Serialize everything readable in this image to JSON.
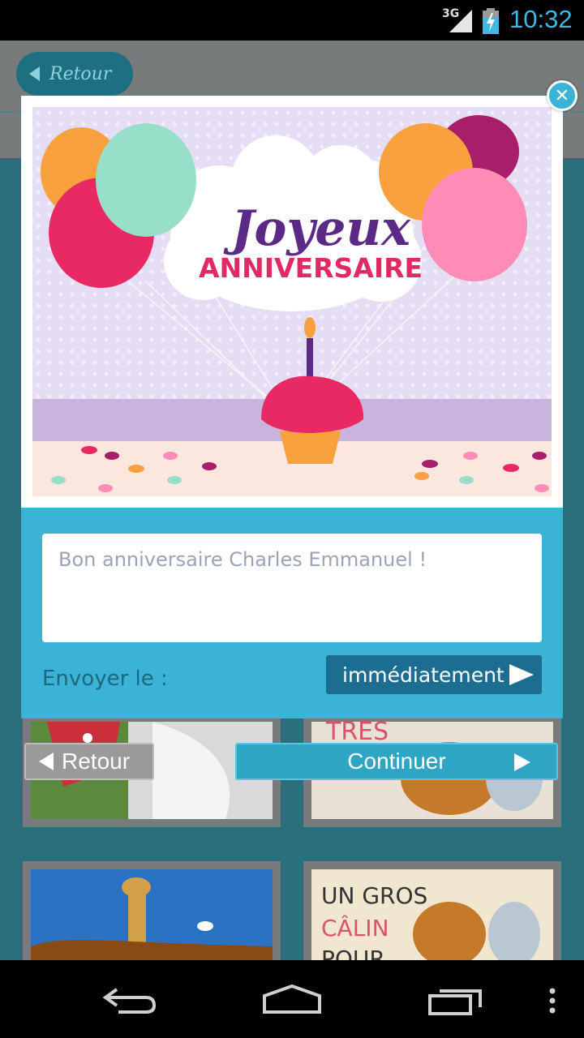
{
  "status_bar": {
    "network": "3G",
    "time": "10:32"
  },
  "header": {
    "back_label": "Retour"
  },
  "grid": {
    "cards": [
      {
        "text": ""
      },
      {
        "text": "TRÈS"
      },
      {
        "text": ""
      },
      {
        "lines": [
          "UN GROS",
          "CÂLIN",
          "POUR"
        ]
      }
    ]
  },
  "card": {
    "title_line1": "Joyeux",
    "title_line2": "ANNIVERSAIRE"
  },
  "message": {
    "value": "Bon anniversaire Charles Emmanuel !"
  },
  "send": {
    "label": "Envoyer le :",
    "when": "immédiatement"
  },
  "buttons": {
    "back": "Retour",
    "continue": "Continuer"
  },
  "colors": {
    "accent": "#3ab3d6",
    "dark_accent": "#1b6e92",
    "time": "#3fb8e6"
  },
  "icons": [
    "close-icon",
    "back-nav-icon",
    "home-nav-icon",
    "recents-nav-icon",
    "menu-nav-icon"
  ]
}
